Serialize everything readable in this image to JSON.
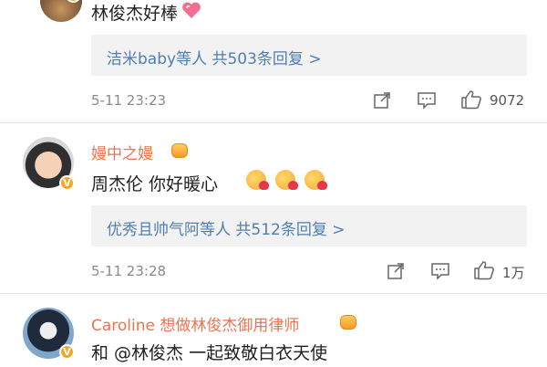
{
  "comments": [
    {
      "text": "林俊杰好棒",
      "reply_summary": "洁米baby等人  共503条回复 >",
      "time": "5-11 23:23",
      "like_count": "9072"
    },
    {
      "username": "嫚中之嫚",
      "text": "周杰伦 你好暖心",
      "reply_summary": "优秀且帅气阿等人  共512条回复 >",
      "time": "5-11 23:28",
      "like_count": "1万"
    },
    {
      "username": "Caroline 想做林俊杰御用律师",
      "text": "和 @林俊杰  一起致敬白衣天使"
    }
  ],
  "icons": {
    "verified": "verified-badge-icon",
    "share": "share-icon",
    "comment": "comment-icon",
    "like": "thumbs-up-icon",
    "heart": "pink-heart-icon",
    "emoji": "kiss-emoji-icon",
    "member_crown": "member-crown-icon"
  },
  "colors": {
    "username": "#eb7350",
    "reply_link": "#4f7fb0",
    "reply_bg": "#f2f2f2",
    "timestamp": "#8a8a8a",
    "verified": "#f5a623"
  }
}
